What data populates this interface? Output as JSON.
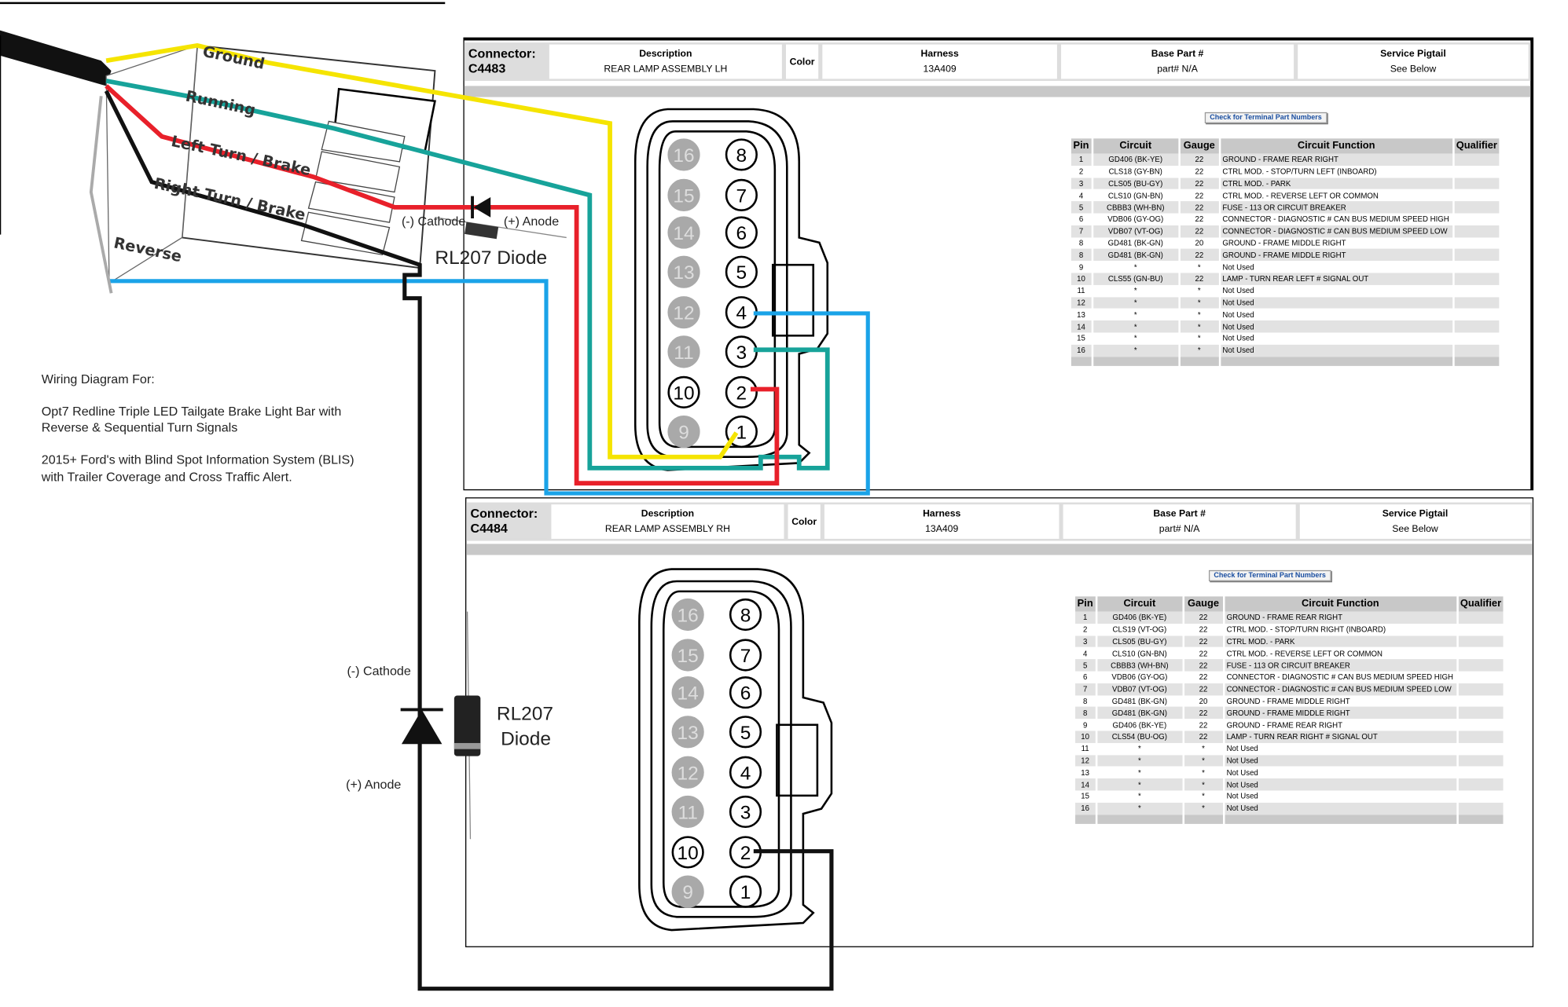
{
  "harness_labels": {
    "ground": "Ground",
    "running": "Running",
    "left_turn": "Left Turn / Brake",
    "right_turn": "Right Turn / Brake",
    "reverse": "Reverse"
  },
  "diode_top": {
    "cathode": "(-) Cathode",
    "anode": "(+) Anode",
    "name": "RL207 Diode"
  },
  "diode_bottom": {
    "cathode": "(-) Cathode",
    "anode": "(+) Anode",
    "name_line1": "RL207",
    "name_line2": "Diode"
  },
  "notes": {
    "line1": "Wiring Diagram For:",
    "line2": "Opt7 Redline Triple LED Tailgate Brake Light Bar with",
    "line3": "Reverse & Sequential Turn Signals",
    "line4": "2015+ Ford's with Blind Spot Information System (BLIS)",
    "line5": "with Trailer Coverage and Cross Traffic Alert."
  },
  "wire_colors": {
    "ground": "#f5e400",
    "running": "#17a39a",
    "left_turn": "#e8202a",
    "right_turn": "#111111",
    "reverse": "#1aa3e8"
  },
  "connectors": [
    {
      "connector_label": "Connector:",
      "connector_id": "C4483",
      "description_label": "Description",
      "description": "REAR LAMP ASSEMBLY LH",
      "color_label": "Color",
      "harness_label": "Harness",
      "harness": "13A409",
      "base_part_label": "Base Part #",
      "base_part": "part# N/A",
      "pigtail_label": "Service Pigtail",
      "pigtail": "See Below",
      "button": "Check for Terminal Part Numbers",
      "columns": [
        "Pin",
        "Circuit",
        "Gauge",
        "Circuit Function",
        "Qualifier"
      ],
      "rows": [
        [
          "1",
          "GD406 (BK-YE)",
          "22",
          "GROUND - FRAME REAR RIGHT"
        ],
        [
          "2",
          "CLS18 (GY-BN)",
          "22",
          "CTRL MOD. - STOP/TURN LEFT (INBOARD)"
        ],
        [
          "3",
          "CLS05 (BU-GY)",
          "22",
          "CTRL MOD. - PARK"
        ],
        [
          "4",
          "CLS10 (GN-BN)",
          "22",
          "CTRL MOD. - REVERSE LEFT OR COMMON"
        ],
        [
          "5",
          "CBBB3 (WH-BN)",
          "22",
          "FUSE - 113 OR CIRCUIT BREAKER"
        ],
        [
          "6",
          "VDB06 (GY-OG)",
          "22",
          "CONNECTOR - DIAGNOSTIC # CAN BUS MEDIUM SPEED HIGH"
        ],
        [
          "7",
          "VDB07 (VT-OG)",
          "22",
          "CONNECTOR - DIAGNOSTIC # CAN BUS MEDIUM SPEED LOW"
        ],
        [
          "8",
          "GD481 (BK-GN)",
          "20",
          "GROUND - FRAME MIDDLE RIGHT"
        ],
        [
          "8",
          "GD481 (BK-GN)",
          "22",
          "GROUND - FRAME MIDDLE RIGHT"
        ],
        [
          "9",
          "*",
          "*",
          "Not Used"
        ],
        [
          "10",
          "CLS55 (GN-BU)",
          "22",
          "LAMP - TURN REAR LEFT # SIGNAL OUT"
        ],
        [
          "11",
          "*",
          "*",
          "Not Used"
        ],
        [
          "12",
          "*",
          "*",
          "Not Used"
        ],
        [
          "13",
          "*",
          "*",
          "Not Used"
        ],
        [
          "14",
          "*",
          "*",
          "Not Used"
        ],
        [
          "15",
          "*",
          "*",
          "Not Used"
        ],
        [
          "16",
          "*",
          "*",
          "Not Used"
        ]
      ]
    },
    {
      "connector_label": "Connector:",
      "connector_id": "C4484",
      "description_label": "Description",
      "description": "REAR LAMP ASSEMBLY RH",
      "color_label": "Color",
      "harness_label": "Harness",
      "harness": "13A409",
      "base_part_label": "Base Part #",
      "base_part": "part# N/A",
      "pigtail_label": "Service Pigtail",
      "pigtail": "See Below",
      "button": "Check for Terminal Part Numbers",
      "columns": [
        "Pin",
        "Circuit",
        "Gauge",
        "Circuit Function",
        "Qualifier"
      ],
      "rows": [
        [
          "1",
          "GD406 (BK-YE)",
          "22",
          "GROUND - FRAME REAR RIGHT"
        ],
        [
          "2",
          "CLS19 (VT-OG)",
          "22",
          "CTRL MOD. - STOP/TURN RIGHT (INBOARD)"
        ],
        [
          "3",
          "CLS05 (BU-GY)",
          "22",
          "CTRL MOD. - PARK"
        ],
        [
          "4",
          "CLS10 (GN-BN)",
          "22",
          "CTRL MOD. - REVERSE LEFT OR COMMON"
        ],
        [
          "5",
          "CBBB3 (WH-BN)",
          "22",
          "FUSE - 113 OR CIRCUIT BREAKER"
        ],
        [
          "6",
          "VDB06 (GY-OG)",
          "22",
          "CONNECTOR - DIAGNOSTIC # CAN BUS MEDIUM SPEED HIGH"
        ],
        [
          "7",
          "VDB07 (VT-OG)",
          "22",
          "CONNECTOR - DIAGNOSTIC # CAN BUS MEDIUM SPEED LOW"
        ],
        [
          "8",
          "GD481 (BK-GN)",
          "20",
          "GROUND - FRAME MIDDLE RIGHT"
        ],
        [
          "8",
          "GD481 (BK-GN)",
          "22",
          "GROUND - FRAME MIDDLE RIGHT"
        ],
        [
          "9",
          "GD406 (BK-YE)",
          "22",
          "GROUND - FRAME REAR RIGHT"
        ],
        [
          "10",
          "CLS54 (BU-OG)",
          "22",
          "LAMP - TURN REAR RIGHT # SIGNAL OUT"
        ],
        [
          "11",
          "*",
          "*",
          "Not Used"
        ],
        [
          "12",
          "*",
          "*",
          "Not Used"
        ],
        [
          "13",
          "*",
          "*",
          "Not Used"
        ],
        [
          "14",
          "*",
          "*",
          "Not Used"
        ],
        [
          "15",
          "*",
          "*",
          "Not Used"
        ],
        [
          "16",
          "*",
          "*",
          "Not Used"
        ]
      ]
    }
  ],
  "pin_layout": {
    "left": [
      "16",
      "15",
      "14",
      "13",
      "12",
      "11",
      "10",
      "9"
    ],
    "right": [
      "8",
      "7",
      "6",
      "5",
      "4",
      "3",
      "2",
      "1"
    ],
    "unused_gray": [
      "16",
      "15",
      "14",
      "13",
      "12",
      "11",
      "9"
    ]
  }
}
